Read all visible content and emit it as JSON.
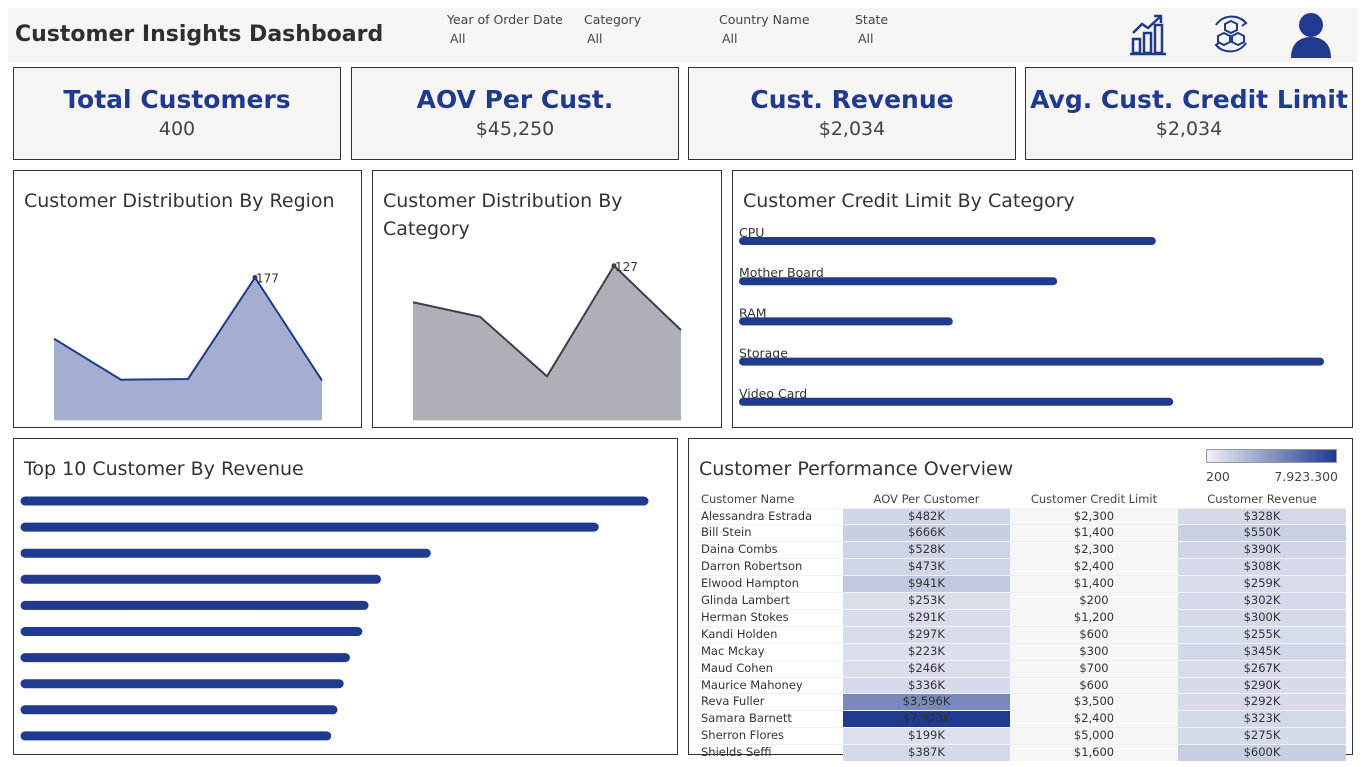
{
  "header": {
    "title": "Customer Insights Dashboard",
    "filters": [
      {
        "label": "Year of Order Date",
        "value": "All"
      },
      {
        "label": "Category",
        "value": "All"
      },
      {
        "label": "Country Name",
        "value": "All"
      },
      {
        "label": "State",
        "value": "All"
      }
    ],
    "icons": [
      "bar-chart-growth-icon",
      "cubes-cycle-icon",
      "user-icon"
    ]
  },
  "colors": {
    "accent": "#1f3a8f",
    "region_fill": "#a3aed0",
    "category_fill": "#aeb0b7",
    "category_line": "#3b3f4a",
    "panel_bg": "#f6f5f3"
  },
  "kpis": [
    {
      "label": "Total Customers",
      "value": "400"
    },
    {
      "label": "AOV Per Cust.",
      "value": "$45,250"
    },
    {
      "label": "Cust. Revenue",
      "value": "$2,034"
    },
    {
      "label": "Avg. Cust. Credit Limit",
      "value": "$2,034"
    }
  ],
  "region_panel": {
    "title": "Customer Distribution By Region"
  },
  "category_panel": {
    "title_line1": "Customer Distribution By",
    "title_line2": "Category"
  },
  "credit_panel": {
    "title": "Customer Credit Limit By Category"
  },
  "top10_panel": {
    "title": "Top 10 Customer By Revenue"
  },
  "performance": {
    "title": "Customer Performance Overview",
    "legend_min": "200",
    "legend_max": "7.923.300",
    "columns": [
      "Customer Name",
      "AOV Per Customer",
      "Customer Credit Limit",
      "Customer Revenue"
    ],
    "rows": [
      {
        "name": "Alessandra Estrada",
        "aov": "$482K",
        "credit": "$2,300",
        "revenue": "$328K",
        "aov_num": 482,
        "rev_num": 328
      },
      {
        "name": "Bill Stein",
        "aov": "$666K",
        "credit": "$1,400",
        "revenue": "$550K",
        "aov_num": 666,
        "rev_num": 550
      },
      {
        "name": "Daina Combs",
        "aov": "$528K",
        "credit": "$2,300",
        "revenue": "$390K",
        "aov_num": 528,
        "rev_num": 390
      },
      {
        "name": "Darron Robertson",
        "aov": "$473K",
        "credit": "$2,400",
        "revenue": "$308K",
        "aov_num": 473,
        "rev_num": 308
      },
      {
        "name": "Elwood Hampton",
        "aov": "$941K",
        "credit": "$1,400",
        "revenue": "$259K",
        "aov_num": 941,
        "rev_num": 259
      },
      {
        "name": "Glinda Lambert",
        "aov": "$253K",
        "credit": "$200",
        "revenue": "$302K",
        "aov_num": 253,
        "rev_num": 302
      },
      {
        "name": "Herman Stokes",
        "aov": "$291K",
        "credit": "$1,200",
        "revenue": "$300K",
        "aov_num": 291,
        "rev_num": 300
      },
      {
        "name": "Kandi Holden",
        "aov": "$297K",
        "credit": "$600",
        "revenue": "$255K",
        "aov_num": 297,
        "rev_num": 255
      },
      {
        "name": "Mac Mckay",
        "aov": "$223K",
        "credit": "$300",
        "revenue": "$345K",
        "aov_num": 223,
        "rev_num": 345
      },
      {
        "name": "Maud Cohen",
        "aov": "$246K",
        "credit": "$700",
        "revenue": "$267K",
        "aov_num": 246,
        "rev_num": 267
      },
      {
        "name": "Maurice Mahoney",
        "aov": "$336K",
        "credit": "$600",
        "revenue": "$290K",
        "aov_num": 336,
        "rev_num": 290
      },
      {
        "name": "Reva Fuller",
        "aov": "$3,596K",
        "credit": "$3,500",
        "revenue": "$292K",
        "aov_num": 3596,
        "rev_num": 292
      },
      {
        "name": "Samara Barnett",
        "aov": "$7,923K",
        "credit": "$2,400",
        "revenue": "$323K",
        "aov_num": 7923,
        "rev_num": 323
      },
      {
        "name": "Sherron Flores",
        "aov": "$199K",
        "credit": "$5,000",
        "revenue": "$275K",
        "aov_num": 199,
        "rev_num": 275
      },
      {
        "name": "Shields Seffi",
        "aov": "$387K",
        "credit": "$1,600",
        "revenue": "$600K",
        "aov_num": 387,
        "rev_num": 600
      }
    ]
  },
  "chart_data": [
    {
      "type": "area",
      "title": "Customer Distribution By Region",
      "x": [
        1,
        2,
        3,
        4,
        5
      ],
      "values": [
        101,
        50,
        51,
        177,
        49
      ],
      "annotations": [
        {
          "index": 3,
          "text": "177"
        }
      ],
      "ylim": [
        0,
        200
      ]
    },
    {
      "type": "area",
      "title": "Customer Distribution By Category",
      "x": [
        1,
        2,
        3,
        4,
        5
      ],
      "values": [
        97,
        85,
        36,
        127,
        74
      ],
      "annotations": [
        {
          "index": 3,
          "text": "127"
        }
      ],
      "ylim": [
        0,
        140
      ]
    },
    {
      "type": "bar",
      "orientation": "horizontal",
      "title": "Customer Credit Limit By Category",
      "categories": [
        "CPU",
        "Mother Board",
        "RAM",
        "Storage",
        "Video Card"
      ],
      "values": [
        71,
        54,
        36,
        100,
        74
      ]
    },
    {
      "type": "bar",
      "orientation": "horizontal",
      "title": "Top 10 Customer By Revenue",
      "categories": [
        "",
        "",
        "",
        "",
        "",
        "",
        "",
        "",
        "",
        ""
      ],
      "values": [
        100,
        92,
        65,
        57,
        55,
        54,
        52,
        51,
        50,
        49
      ]
    }
  ]
}
